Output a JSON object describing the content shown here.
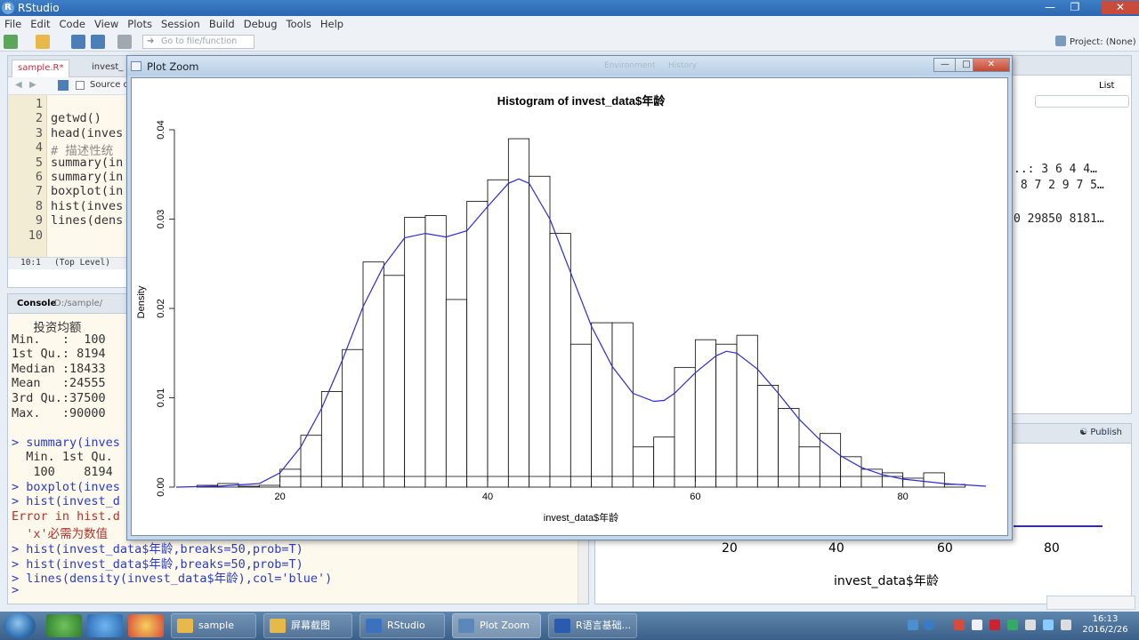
{
  "app": {
    "title": "RStudio"
  },
  "menu": [
    "File",
    "Edit",
    "Code",
    "View",
    "Plots",
    "Session",
    "Build",
    "Debug",
    "Tools",
    "Help"
  ],
  "toolbar": {
    "goto_placeholder": "Go to file/function",
    "project_label": "Project: (None)"
  },
  "editor": {
    "tabs": [
      "sample.R*",
      "invest_"
    ],
    "source_on_save": "Source on",
    "lines": [
      {
        "n": "1",
        "code": ""
      },
      {
        "n": "2",
        "code": "getwd()"
      },
      {
        "n": "3",
        "code": "head(inves"
      },
      {
        "n": "4",
        "code": "# 描述性统"
      },
      {
        "n": "5",
        "code": "summary(in"
      },
      {
        "n": "6",
        "code": "summary(in"
      },
      {
        "n": "7",
        "code": "boxplot(in"
      },
      {
        "n": "8",
        "code": "hist(inves"
      },
      {
        "n": "9",
        "code": "lines(dens"
      },
      {
        "n": "10",
        "code": ""
      }
    ],
    "cursor_pos": "10:1",
    "scope": "(Top Level)"
  },
  "console": {
    "title": "Console",
    "path": "D:/sample/",
    "lines": [
      {
        "t": "out",
        "text": "   投资均额"
      },
      {
        "t": "out",
        "text": "Min.   :  100"
      },
      {
        "t": "out",
        "text": "1st Qu.: 8194"
      },
      {
        "t": "out",
        "text": "Median :18433"
      },
      {
        "t": "out",
        "text": "Mean   :24555"
      },
      {
        "t": "out",
        "text": "3rd Qu.:37500"
      },
      {
        "t": "out",
        "text": "Max.   :90000"
      },
      {
        "t": "blank",
        "text": ""
      },
      {
        "t": "cmd",
        "text": "> summary(inves"
      },
      {
        "t": "out",
        "text": "  Min. 1st Qu."
      },
      {
        "t": "out",
        "text": "   100    8194"
      },
      {
        "t": "cmd",
        "text": "> boxplot(inves"
      },
      {
        "t": "cmd",
        "text": "> hist(invest_d"
      },
      {
        "t": "err",
        "text": "Error in hist.d"
      },
      {
        "t": "err",
        "text": "  'x'必需为数值"
      },
      {
        "t": "cmd",
        "text": "> hist(invest_data$年龄,breaks=50,prob=T)"
      },
      {
        "t": "cmd",
        "text": "> hist(invest_data$年龄,breaks=50,prob=T)"
      },
      {
        "t": "cmd",
        "text": "> lines(density(invest_data$年龄),col='blue')"
      },
      {
        "t": "cmd",
        "text": ">"
      }
    ]
  },
  "environment": {
    "list_label": "List",
    "rows": [
      "..: 3 6 4 4…",
      " 8 7 2 9 7 5…",
      "0 29850 8181…"
    ]
  },
  "plots_pane": {
    "publish_label": "Publish",
    "ticks": [
      "20",
      "40",
      "60",
      "80"
    ],
    "xlabel": "invest_data$年龄"
  },
  "plot_zoom": {
    "window_title": "Plot Zoom",
    "bg_tabs": [
      "Environment",
      "History"
    ]
  },
  "chart_data": {
    "type": "bar",
    "title": "Histogram of invest_data$年龄",
    "xlabel": "invest_data$年龄",
    "ylabel": "Density",
    "xlim": [
      10,
      88
    ],
    "ylim": [
      0,
      0.04
    ],
    "xticks": [
      "20",
      "40",
      "60",
      "80"
    ],
    "yticks": [
      "0.00",
      "0.01",
      "0.02",
      "0.03",
      "0.04"
    ],
    "bin_width": 2,
    "bins_start": [
      10,
      12,
      14,
      16,
      18,
      20,
      22,
      24,
      26,
      28,
      30,
      32,
      34,
      36,
      38,
      40,
      42,
      44,
      46,
      48,
      50,
      52,
      54,
      56,
      58,
      60,
      62,
      64,
      66,
      68,
      70,
      72,
      74,
      76,
      78,
      80,
      82,
      84
    ],
    "values": [
      0.0,
      0.0002,
      0.0004,
      0.0001,
      0.0002,
      0.002,
      0.0058,
      0.0107,
      0.0154,
      0.0252,
      0.0237,
      0.0302,
      0.0304,
      0.021,
      0.032,
      0.0344,
      0.039,
      0.0348,
      0.0284,
      0.016,
      0.0184,
      0.0184,
      0.0045,
      0.0056,
      0.0134,
      0.0165,
      0.016,
      0.017,
      0.0114,
      0.0088,
      0.0045,
      0.006,
      0.0034,
      0.002,
      0.0016,
      0.001,
      0.0016,
      0.0003
    ],
    "series": [
      {
        "type": "line",
        "color": "#2c2cd4",
        "x": [
          10,
          14,
          18,
          20,
          22,
          24,
          26,
          28,
          30,
          32,
          34,
          36,
          38,
          40,
          42,
          43,
          44,
          46,
          48,
          50,
          52,
          54,
          56,
          57,
          58,
          60,
          62,
          63,
          64,
          66,
          68,
          70,
          72,
          74,
          76,
          78,
          80,
          84,
          88
        ],
        "y": [
          0.0,
          0.0001,
          0.0004,
          0.0016,
          0.0045,
          0.0088,
          0.0142,
          0.0202,
          0.0248,
          0.0279,
          0.0284,
          0.028,
          0.0287,
          0.0314,
          0.034,
          0.0345,
          0.034,
          0.03,
          0.024,
          0.018,
          0.0135,
          0.0105,
          0.0096,
          0.0097,
          0.0105,
          0.0128,
          0.0147,
          0.0152,
          0.015,
          0.0132,
          0.0105,
          0.0076,
          0.0053,
          0.0035,
          0.0022,
          0.0014,
          0.0009,
          0.0004,
          0.0001
        ]
      }
    ]
  },
  "taskbar": {
    "tasks": [
      "sample",
      "屏幕截图",
      "RStudio",
      "Plot Zoom",
      "R语言基础..."
    ],
    "time": "16:13",
    "date": "2016/2/26"
  },
  "colors": {
    "histogram_bar": "#ffffff",
    "density_line": "#2c2cd4",
    "titlebar": "#2c66b0"
  }
}
